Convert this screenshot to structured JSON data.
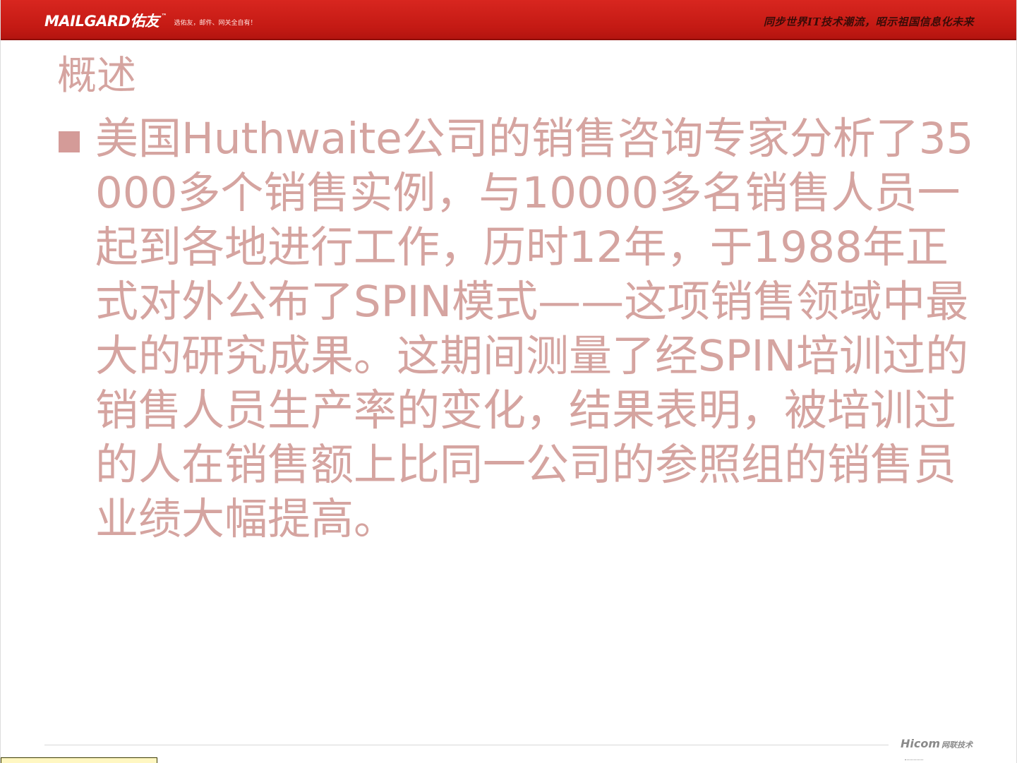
{
  "header": {
    "brand_logo": "MAILGARD佑友",
    "brand_tm": "™",
    "brand_slogan": "选佑友，邮件、网关全自有！",
    "tagline": "同步世界IT技术潮流，昭示祖国信息化未来"
  },
  "slide": {
    "title": "概述",
    "bullet_text": "美国Huthwaite公司的销售咨询专家分析了35000多个销售实例，与10000多名销售人员一起到各地进行工作，历时12年，于1988年正式对外公布了SPIN模式——这项销售领域中最大的研究成果。这期间测量了经SPIN培训过的销售人员生产率的变化，结果表明，被培训过的人在销售额上比同一公司的参照组的销售员业绩大幅提高。"
  },
  "footer": {
    "brand": "Hicom",
    "brand_cn": "网联技术"
  },
  "colors": {
    "header_red": "#c41a14",
    "text_pink": "#d5a4a0",
    "bullet_pink": "#d49b98"
  }
}
